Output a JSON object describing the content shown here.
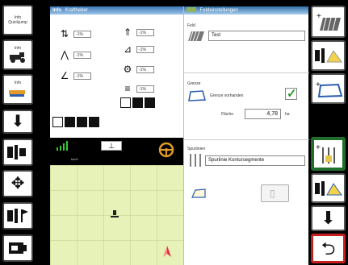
{
  "left_buttons": [
    {
      "label": "Info",
      "sub": "Quickjump",
      "icon": "info-icon"
    },
    {
      "label": "Info",
      "sub": "",
      "icon": "tractor-info-icon"
    },
    {
      "label": "Info",
      "sub": "",
      "icon": "implement-info-icon"
    },
    {
      "label": "",
      "sub": "",
      "icon": "arrow-down-icon"
    },
    {
      "label": "",
      "sub": "",
      "icon": "tractor-implement-icon"
    },
    {
      "label": "",
      "sub": "",
      "icon": "move-icon"
    },
    {
      "label": "",
      "sub": "",
      "icon": "tractor-flag-icon"
    },
    {
      "label": "",
      "sub": "",
      "icon": "terminal-icon"
    }
  ],
  "hydraulics": {
    "title": "Kraftheber",
    "badge": "Info",
    "left_values": [
      "-1%",
      "-1%",
      "-1%"
    ],
    "right_values": [
      "-1%",
      "-1%",
      "-1%",
      "-1%"
    ]
  },
  "field_settings": {
    "title": "Feldeinstellungen",
    "field_label": "Feld",
    "field_value": "Test",
    "boundary_label": "Grenze",
    "boundary_exists_label": "Grenze vorhanden",
    "boundary_checked": true,
    "area_label": "Fläche",
    "area_value": "4,78",
    "area_unit": "ha",
    "track_label": "Spurlinien",
    "track_value": "Spurlinie Kontursegmente"
  },
  "status": {
    "signal": "signal-icon",
    "speed_text": "km/h"
  },
  "colors": {
    "title_bar": "#3d7ab8",
    "map_bg": "#e7f2b8",
    "highlight_green": "#1f6f2a",
    "highlight_red": "#c42020",
    "check_green": "#2e9a2e"
  }
}
